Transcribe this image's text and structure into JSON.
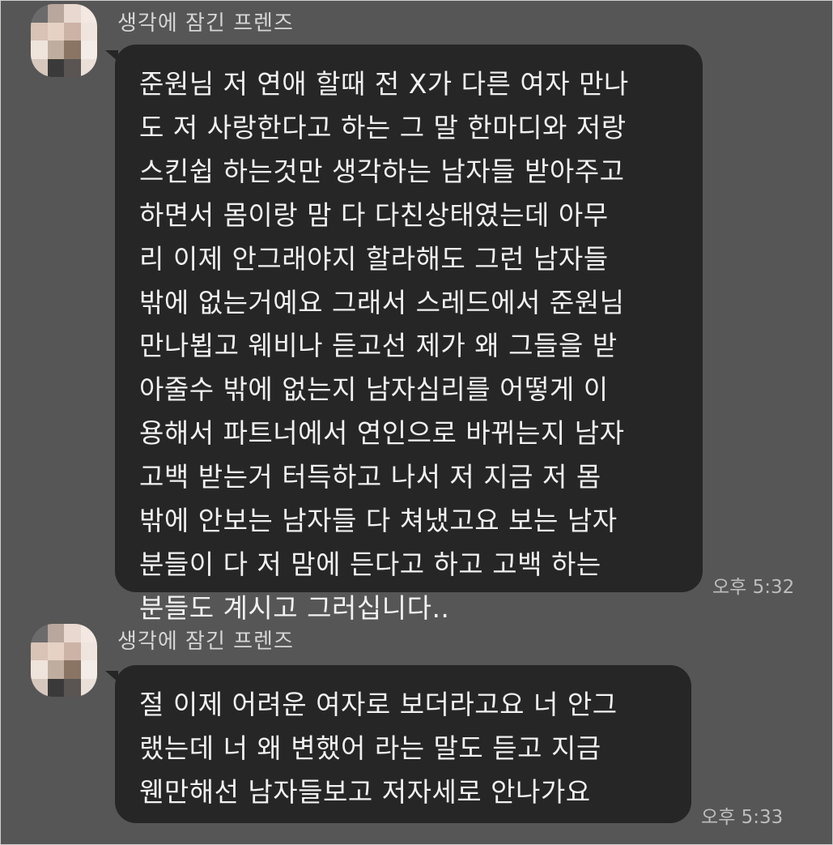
{
  "messages": [
    {
      "sender": "생각에 잠긴 프렌즈",
      "lines": [
        "준원님 저 연애 할때 전 X가 다른 여자 만나",
        "도 저 사랑한다고 하는 그 말 한마디와 저랑",
        "스킨쉽 하는것만 생각하는 남자들 받아주고",
        "하면서 몸이랑 맘 다 다친상태였는데 아무",
        "리 이제 안그래야지 할라해도 그런 남자들",
        "밖에 없는거예요 그래서 스레드에서 준원님",
        "만나뵙고 웨비나 듣고선 제가 왜 그들을 받",
        "아줄수 밖에 없는지 남자심리를 어떻게 이",
        "용해서 파트너에서 연인으로 바뀌는지 남자",
        "고백 받는거 터득하고 나서 저 지금 저 몸",
        "밖에 안보는 남자들 다 쳐냈고요 보는 남자",
        "분들이 다 저 맘에 든다고 하고 고백 하는",
        "분들도 계시고 그러십니다.."
      ],
      "time": "오후 5:32"
    },
    {
      "sender": "생각에 잠긴 프렌즈",
      "lines": [
        "절 이제 어려운 여자로 보더라고요 너 안그",
        "랬는데 너 왜 변했어 라는 말도 듣고 지금",
        "웬만해선 남자들보고 저자세로 안나가요"
      ],
      "time": "오후 5:33"
    }
  ],
  "avatar": {
    "icon": "pixelated-avatar-icon",
    "colors": [
      "#6b6b6b",
      "#b9a79d",
      "#e8d8cf",
      "#f3e9e2",
      "#d9c3b6",
      "#e6d2c5",
      "#cdb3a6",
      "#f0e5de",
      "#efe4dc",
      "#bfae9f",
      "#8a7565",
      "#f4ece6",
      "#d7c8bd",
      "#3a3a3a",
      "#5a5553",
      "#eae0d8"
    ]
  },
  "colors": {
    "background": "#565656",
    "bubble": "#262626",
    "text": "#f1f1f1",
    "sender": "#d6d6d6",
    "time": "#bdbdbd"
  }
}
